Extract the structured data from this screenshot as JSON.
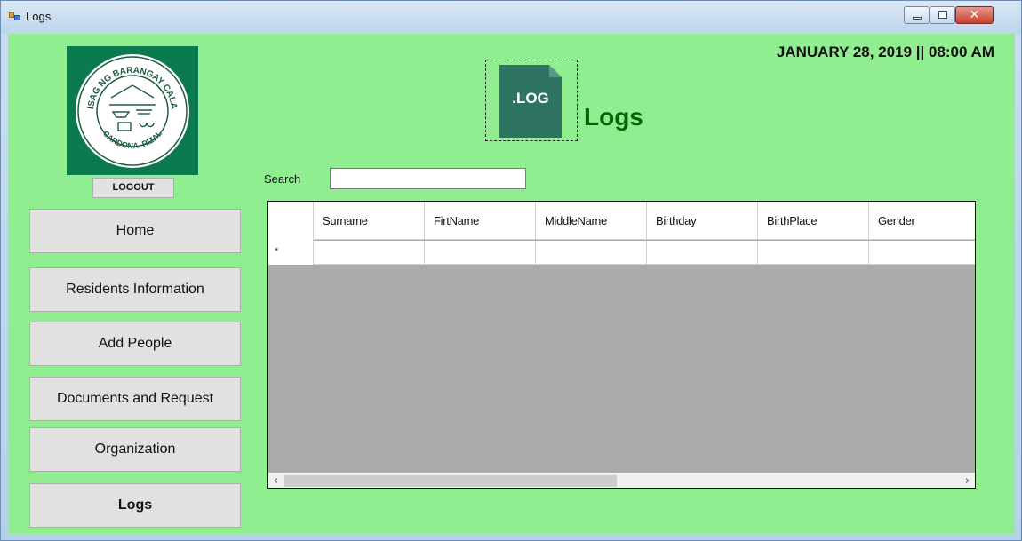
{
  "window": {
    "title": "Logs",
    "min_icon": "minimize-icon",
    "max_icon": "maximize-icon",
    "close_icon": "close-icon"
  },
  "header": {
    "datetime": "JANUARY 28, 2019 || 08:00 AM",
    "title": "Logs",
    "file_icon_label": ".LOG"
  },
  "sidebar": {
    "logout_label": "LOGOUT",
    "seal_text_top": "SAGISAG NG BARANGAY CALAHAN",
    "seal_text_bottom": "CARDONA, RIZAL",
    "items": [
      {
        "label": "Home"
      },
      {
        "label": "Residents Information"
      },
      {
        "label": "Add People"
      },
      {
        "label": "Documents and Request"
      },
      {
        "label": "Organization"
      },
      {
        "label": "Logs",
        "active": true
      }
    ]
  },
  "search": {
    "label": "Search",
    "value": ""
  },
  "grid": {
    "columns": [
      "Surname",
      "FirtName",
      "MiddleName",
      "Birthday",
      "BirthPlace",
      "Gender"
    ],
    "new_row_marker": "*"
  },
  "colors": {
    "background": "#90ee90",
    "title": "#006400",
    "seal": "#0b7a4f",
    "file_icon": "#2e7461"
  }
}
